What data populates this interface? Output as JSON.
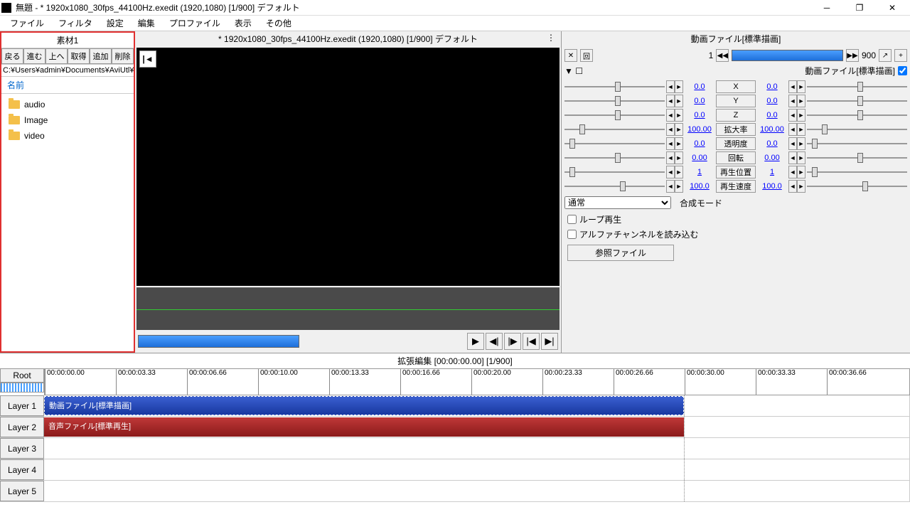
{
  "title": "無題 - * 1920x1080_30fps_44100Hz.exedit (1920,1080)  [1/900]  デフォルト",
  "menu": [
    "ファイル",
    "フィルタ",
    "設定",
    "編集",
    "プロファイル",
    "表示",
    "その他"
  ],
  "material": {
    "title": "素材1",
    "buttons": [
      "戻る",
      "進む",
      "上へ",
      "取得",
      "追加",
      "削除"
    ],
    "path": "C:¥Users¥admin¥Documents¥AviUtl¥p",
    "header": "名前",
    "items": [
      "audio",
      "Image",
      "video"
    ]
  },
  "preview": {
    "title": "* 1920x1080_30fps_44100Hz.exedit (1920,1080)  [1/900]  デフォルト"
  },
  "props": {
    "title": "動画ファイル[標準描画]",
    "frame_start": "1",
    "frame_end": "900",
    "sub_label": "動画ファイル[標準描画]",
    "rows": [
      {
        "l": "0.0",
        "btn": "X",
        "r": "0.0",
        "lp": 50,
        "rp": 50
      },
      {
        "l": "0.0",
        "btn": "Y",
        "r": "0.0",
        "lp": 50,
        "rp": 50
      },
      {
        "l": "0.0",
        "btn": "Z",
        "r": "0.0",
        "lp": 50,
        "rp": 50
      },
      {
        "l": "100.00",
        "btn": "拡大率",
        "r": "100.00",
        "lp": 15,
        "rp": 15
      },
      {
        "l": "0.0",
        "btn": "透明度",
        "r": "0.0",
        "lp": 5,
        "rp": 5
      },
      {
        "l": "0.00",
        "btn": "回転",
        "r": "0.00",
        "lp": 50,
        "rp": 50
      },
      {
        "l": "1",
        "btn": "再生位置",
        "r": "1",
        "lp": 5,
        "rp": 5
      },
      {
        "l": "100.0",
        "btn": "再生速度",
        "r": "100.0",
        "lp": 55,
        "rp": 55
      }
    ],
    "blend_label": "合成モード",
    "blend_value": "通常",
    "loop": "ループ再生",
    "alpha": "アルファチャンネルを読み込む",
    "ref": "参照ファイル"
  },
  "timeline": {
    "title": "拡張編集 [00:00:00.00] [1/900]",
    "root": "Root",
    "ticks": [
      "00:00:00.00",
      "00:00:03.33",
      "00:00:06.66",
      "00:00:10.00",
      "00:00:13.33",
      "00:00:16.66",
      "00:00:20.00",
      "00:00:23.33",
      "00:00:26.66",
      "00:00:30.00",
      "00:00:33.33",
      "00:00:36.66"
    ],
    "layers": [
      "Layer 1",
      "Layer 2",
      "Layer 3",
      "Layer 4",
      "Layer 5"
    ],
    "clip_video": "動画ファイル[標準描画]",
    "clip_audio": "音声ファイル[標準再生]"
  }
}
